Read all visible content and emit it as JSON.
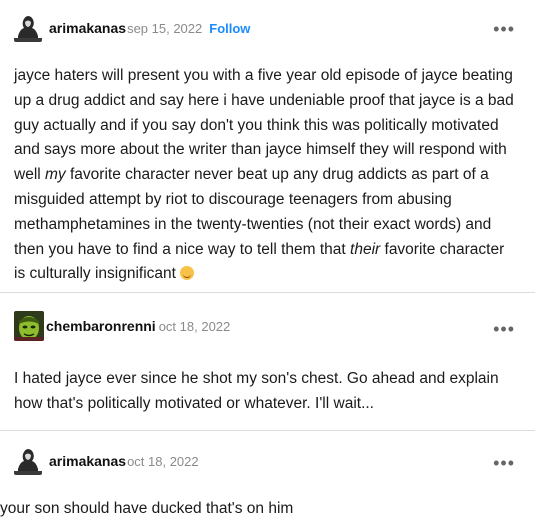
{
  "posts": [
    {
      "username": "arimakanas",
      "date": "sep 15, 2022",
      "follow_label": "Follow",
      "more_label": "•••",
      "text_segments": [
        " jayce haters will present you with a  five year old episode of  jayce beating up a drug addict and say here i have undeniable proof that   jayce  is a bad guy actually and if you say don't you think this was politically motivated and says more about the writer than  jayce himself they will respond with well ",
        "my",
        " favorite character never beat up any drug addicts as part of a misguided attempt by riot to discourage teenagers from abusing methamphetamines in the twenty-twenties (not their exact words) and then you have to find a nice way to tell them that ",
        "their",
        " favorite character is culturally insignificant "
      ],
      "emoji": "relieved-face-emoji"
    },
    {
      "username": "chembaronrenni",
      "date": "oct 18, 2022",
      "more_label": "•••",
      "text": "I hated  jayce  ever since he shot my son's chest. Go ahead and explain how that's politically motivated or whatever. I'll wait..."
    },
    {
      "username": "arimakanas",
      "date": "oct 18, 2022",
      "more_label": "•••",
      "text": "your son should have ducked that's on him"
    }
  ],
  "colors": {
    "link_blue": "#1a8cff",
    "meta_gray": "#8a8a8a",
    "divider": "#dcdcdc"
  }
}
